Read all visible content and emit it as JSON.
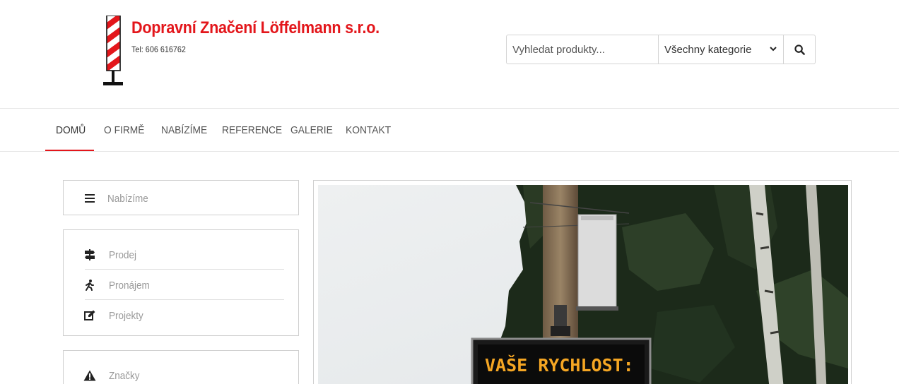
{
  "brand": {
    "name": "Dopravní Značení Löffelmann s.r.o.",
    "phone": "Tel: 606 616762"
  },
  "search": {
    "placeholder": "Vyhledat produkty...",
    "category_selected": "Všechny kategorie",
    "search_icon": "search-icon"
  },
  "nav": {
    "items": [
      {
        "label": "DOMŮ",
        "active": true
      },
      {
        "label": "O FIRMĚ",
        "active": false
      },
      {
        "label": "NABÍZÍME",
        "active": false
      },
      {
        "label": "REFERENCE",
        "active": false
      },
      {
        "label": "GALERIE",
        "active": false
      },
      {
        "label": "KONTAKT",
        "active": false
      }
    ]
  },
  "sidebar": {
    "menu_toggle": {
      "label": "Nabízíme",
      "icon": "menu-icon"
    },
    "group1": [
      {
        "label": "Prodej",
        "icon": "signpost-icon"
      },
      {
        "label": "Pronájem",
        "icon": "walking-person-icon"
      },
      {
        "label": "Projekty",
        "icon": "edit-icon"
      }
    ],
    "group2": [
      {
        "label": "Značky",
        "icon": "warning-icon"
      }
    ]
  },
  "slider": {
    "sign_text": "VAŠE RYCHLOST:"
  },
  "colors": {
    "accent": "#e3161b",
    "sign_text": "#f5a623"
  }
}
